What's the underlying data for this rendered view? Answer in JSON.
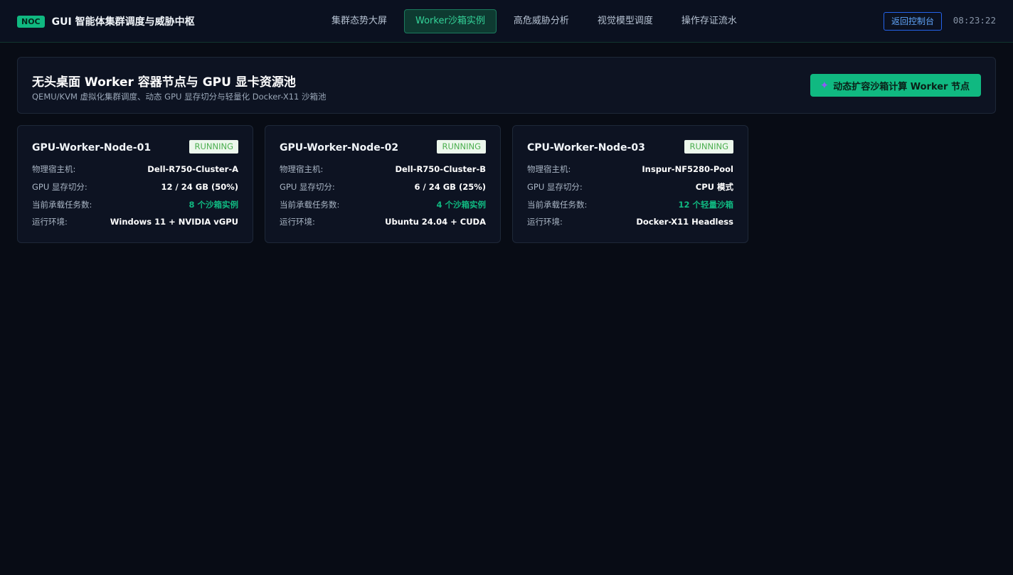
{
  "topbar": {
    "badge": "NOC",
    "title": "GUI 智能体集群调度与威胁中枢",
    "tabs": [
      {
        "label": "集群态势大屏",
        "active": false
      },
      {
        "label": "Worker沙箱实例",
        "active": true
      },
      {
        "label": "高危威胁分析",
        "active": false
      },
      {
        "label": "视觉模型调度",
        "active": false
      },
      {
        "label": "操作存证流水",
        "active": false
      }
    ],
    "back_label": "返回控制台",
    "clock": "08:23:22"
  },
  "header": {
    "title": "无头桌面 Worker 容器节点与 GPU 显卡资源池",
    "subtitle": "QEMU/KVM 虚拟化集群调度、动态 GPU 显存切分与轻量化 Docker-X11 沙箱池",
    "scale_button_icon": "sparkle-icon",
    "scale_button_label": "动态扩容沙箱计算 Worker 节点"
  },
  "labels": {
    "host": "物理宿主机:",
    "gpu": "GPU 显存切分:",
    "tasks": "当前承载任务数:",
    "env": "运行环境:"
  },
  "nodes": [
    {
      "name": "GPU-Worker-Node-01",
      "status": "RUNNING",
      "host": "Dell-R750-Cluster-A",
      "gpu": "12 / 24 GB (50%)",
      "tasks": "8 个沙箱实例",
      "env": "Windows 11 + NVIDIA vGPU"
    },
    {
      "name": "GPU-Worker-Node-02",
      "status": "RUNNING",
      "host": "Dell-R750-Cluster-B",
      "gpu": "6 / 24 GB (25%)",
      "tasks": "4 个沙箱实例",
      "env": "Ubuntu 24.04 + CUDA"
    },
    {
      "name": "CPU-Worker-Node-03",
      "status": "RUNNING",
      "host": "Inspur-NF5280-Pool",
      "gpu": "CPU 模式",
      "tasks": "12 个轻量沙箱",
      "env": "Docker-X11 Headless"
    }
  ],
  "colors": {
    "accent": "#10b981",
    "background": "#080c15",
    "panel": "#0d1322",
    "status_badge_bg": "#ecf7ec",
    "status_badge_text": "#4caf50",
    "link": "#60a5fa"
  }
}
